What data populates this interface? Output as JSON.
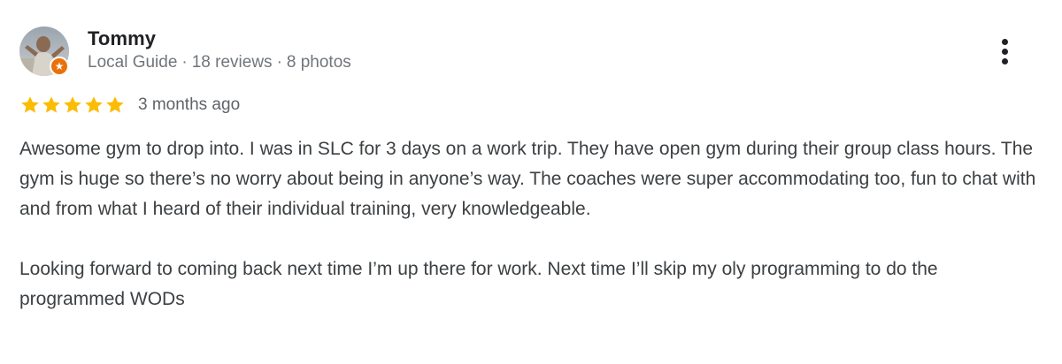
{
  "reviewer": {
    "name": "Tommy",
    "role": "Local Guide",
    "separator": "·",
    "reviews": "18 reviews",
    "photos": "8 photos",
    "badge_icon": "star-badge-icon",
    "badge_color": "#e8710a"
  },
  "rating": {
    "stars": 5,
    "max_stars": 5,
    "star_color": "#fbbc04",
    "date": "3 months ago"
  },
  "review": {
    "paragraphs": [
      "Awesome gym to drop into. I was in SLC for 3 days on a work trip. They have open gym during their group class hours. The gym is huge so there’s no worry about being in anyone’s way. The coaches were super accommodating too, fun to chat with and from what I heard of their individual training, very knowledgeable.",
      "Looking forward to coming back next time I’m up there for work. Next time I’ll skip my oly programming to do the programmed WODs"
    ]
  },
  "actions": {
    "more_icon": "more-vert-icon"
  }
}
